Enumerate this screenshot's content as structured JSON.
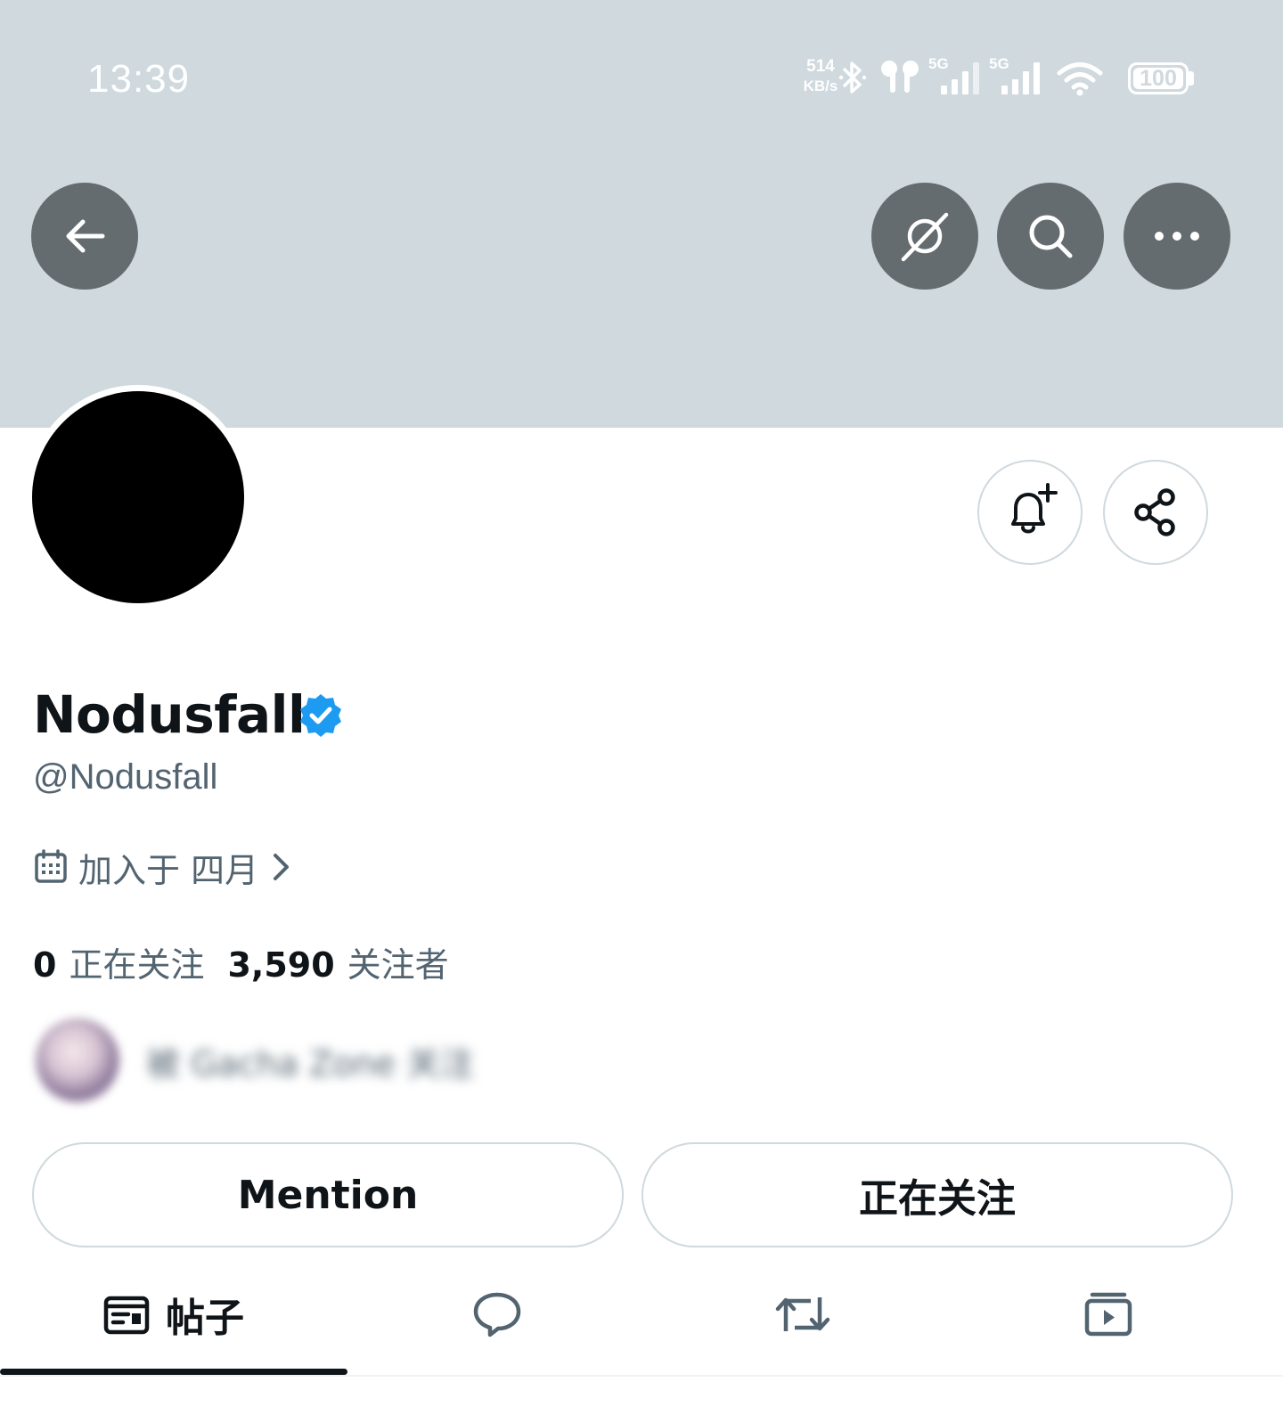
{
  "status_bar": {
    "time": "13:39",
    "net_speed_value": "514",
    "net_speed_unit": "KB/s",
    "sim1_label": "5G",
    "sim2_label": "5G",
    "battery": "100"
  },
  "profile": {
    "display_name": "Nodusfall",
    "handle": "@Nodusfall",
    "joined": "加入于 四月",
    "following_count": "0",
    "following_label": "正在关注",
    "followers_count": "3,590",
    "followers_label": "关注者",
    "followed_by_text": "被 Gacha Zone 关注"
  },
  "actions": {
    "mention_label": "Mention",
    "following_button_label": "正在关注"
  },
  "tabs": [
    {
      "label": "帖子",
      "icon": "posts-icon",
      "active": true
    },
    {
      "label": "",
      "icon": "replies-icon",
      "active": false
    },
    {
      "label": "",
      "icon": "reposts-icon",
      "active": false
    },
    {
      "label": "",
      "icon": "media-icon",
      "active": false
    }
  ],
  "colors": {
    "banner": "#cfd9de",
    "overlay_button": "#656c70",
    "verified": "#1d9bf0",
    "secondary_text": "#536471",
    "primary_text": "#0f1419"
  }
}
